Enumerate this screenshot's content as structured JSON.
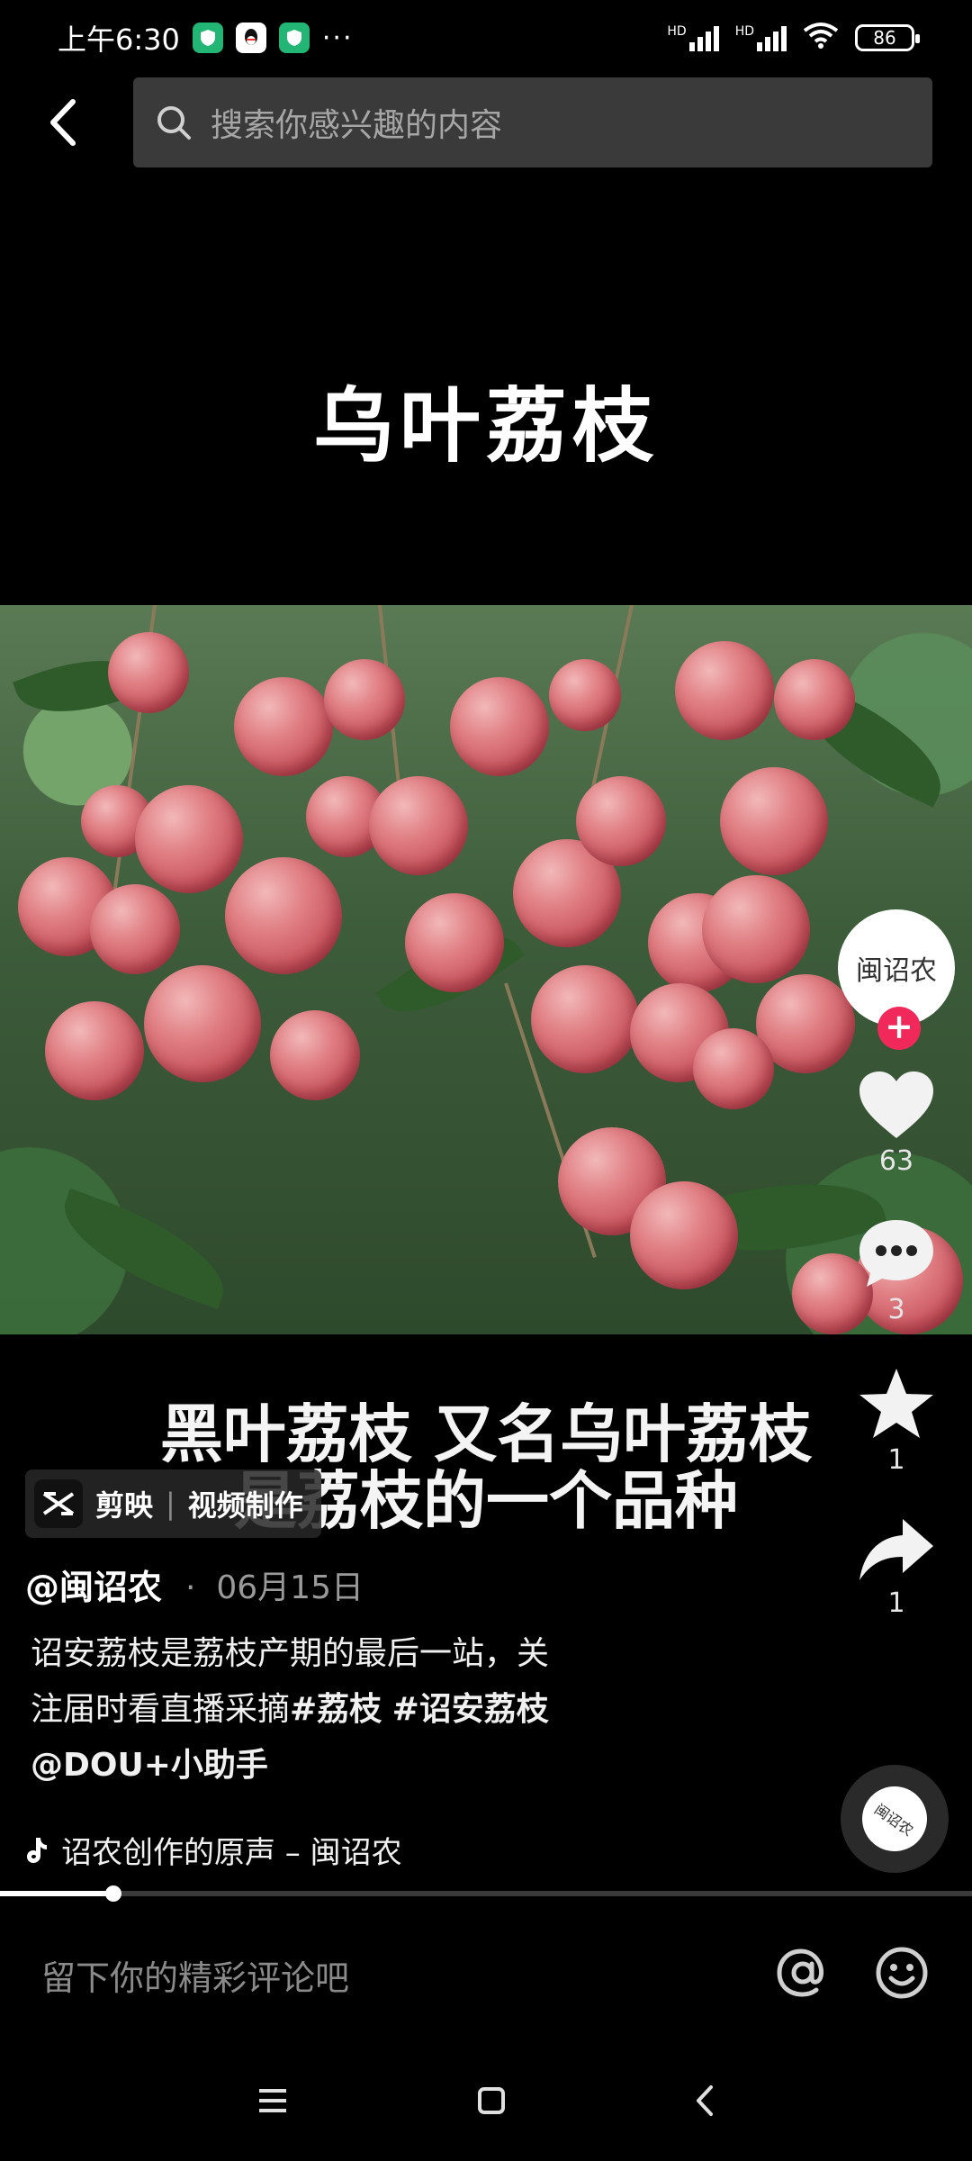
{
  "status_bar": {
    "time": "上午6:30",
    "network_label": "HD",
    "battery": "86"
  },
  "search": {
    "placeholder": "搜索你感兴趣的内容"
  },
  "video": {
    "title_overlay": "乌叶荔枝",
    "caption_line1": "黑叶荔枝 又名乌叶荔枝",
    "caption_line2": "是荔枝的一个品种",
    "playback_progress": 0.117
  },
  "capcut_badge": {
    "brand": "剪映",
    "separator": "|",
    "label": "视频制作"
  },
  "actions": {
    "avatar_text": "闽诏农",
    "follow_label": "+",
    "likes": "63",
    "comments": "3",
    "favorites": "1",
    "shares": "1"
  },
  "post": {
    "author": "@闽诏农",
    "dot": "·",
    "date": "06月15日",
    "desc_line1": "诏安荔枝是荔枝产期的最后一站，关",
    "desc_line2_text": "注届时看直播采摘",
    "tag1": "#荔枝",
    "tag2": "#诏安荔枝",
    "mention": "@DOU+小助手",
    "music": "诏农创作的原声 – 闽诏农",
    "music_disc_text": "闽诏农"
  },
  "comment": {
    "placeholder": "留下你的精彩评论吧"
  },
  "icons": {
    "back": "chevron-left-icon",
    "search": "search-icon",
    "like": "heart-icon",
    "comment": "speech-bubble-icon",
    "favorite": "star-icon",
    "share": "share-arrow-icon",
    "music": "tiktok-note-icon",
    "at": "at-sign-icon",
    "emoji": "emoji-icon"
  },
  "colors": {
    "background": "#000000",
    "follow_red": "#f0295a",
    "search_bg": "#3a3a3a",
    "muted_text": "#9a9a9a"
  }
}
